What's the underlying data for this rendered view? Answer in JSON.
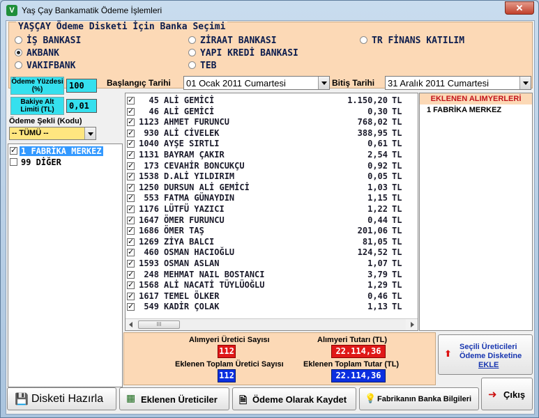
{
  "window": {
    "title": "Yaş Çay Bankamatik Ödeme İşlemleri",
    "close": "✕"
  },
  "bank_group": {
    "title": "YAŞÇAY Ödeme Disketi İçin Banka Seçimi",
    "options": [
      {
        "label": "İŞ BANKASI",
        "selected": false
      },
      {
        "label": "AKBANK",
        "selected": true
      },
      {
        "label": "VAKIFBANK",
        "selected": false
      },
      {
        "label": "ZİRAAT BANKASI",
        "selected": false
      },
      {
        "label": "YAPI KREDİ BANKASI",
        "selected": false
      },
      {
        "label": "TEB",
        "selected": false
      },
      {
        "label": "TR FİNANS KATILIM",
        "selected": false
      }
    ]
  },
  "params": {
    "payment_pct_label": "Ödeme Yüzdesi (%)",
    "payment_pct_value": "100",
    "debt_limit_label": "Bakiye Alt Limiti (TL)",
    "debt_limit_value": "0,01",
    "payment_type_label": "Ödeme Şekli (Kodu)",
    "payment_type_value": "-- TÜMÜ --",
    "start_label": "Başlangıç Tarihi",
    "start_value": "01   Ocak   2011 Cumartesi",
    "end_label": "Bitiş Tarihi",
    "end_value": "31  Aralık  2011 Cumartesi"
  },
  "factories": [
    {
      "label": "1 FABRİKA MERKEZ",
      "checked": true,
      "selected": true
    },
    {
      "label": "99 DİĞER",
      "checked": false,
      "selected": false
    }
  ],
  "producers": [
    {
      "code": "45",
      "name": "ALİ GEMİCİ",
      "amount": "1.150,20",
      "cur": "TL"
    },
    {
      "code": "46",
      "name": "ALİ GEMİCİ",
      "amount": "0,30",
      "cur": "TL"
    },
    {
      "code": "1123",
      "name": "AHMET FURUNCU",
      "amount": "768,02",
      "cur": "TL"
    },
    {
      "code": "930",
      "name": "ALİ CİVELEK",
      "amount": "388,95",
      "cur": "TL"
    },
    {
      "code": "1040",
      "name": "AYŞE SIRTLI",
      "amount": "0,61",
      "cur": "TL"
    },
    {
      "code": "1131",
      "name": "BAYRAM ÇAKIR",
      "amount": "2,54",
      "cur": "TL"
    },
    {
      "code": "173",
      "name": "CEVAHİR BONCUKÇU",
      "amount": "0,92",
      "cur": "TL"
    },
    {
      "code": "1538",
      "name": "D.ALİ YILDIRIM",
      "amount": "0,05",
      "cur": "TL"
    },
    {
      "code": "1250",
      "name": "DURSUN ALİ GEMİCİ",
      "amount": "1,03",
      "cur": "TL"
    },
    {
      "code": "553",
      "name": "FATMA GÜNAYDIN",
      "amount": "1,15",
      "cur": "TL"
    },
    {
      "code": "1176",
      "name": "LÜTFÜ YAZICI",
      "amount": "1,22",
      "cur": "TL"
    },
    {
      "code": "1647",
      "name": "ÖMER FURUNCU",
      "amount": "0,44",
      "cur": "TL"
    },
    {
      "code": "1686",
      "name": "ÖMER TAŞ",
      "amount": "201,06",
      "cur": "TL"
    },
    {
      "code": "1269",
      "name": "ZİYA BALCI",
      "amount": "81,05",
      "cur": "TL"
    },
    {
      "code": "460",
      "name": "OSMAN HACIOĞLU",
      "amount": "124,52",
      "cur": "TL"
    },
    {
      "code": "1593",
      "name": "OSMAN ASLAN",
      "amount": "1,07",
      "cur": "TL"
    },
    {
      "code": "248",
      "name": "MEHMAT NAIL BOSTANCI",
      "amount": "3,79",
      "cur": "TL"
    },
    {
      "code": "1568",
      "name": "ALİ  NACATİ TÜYLÜOĞLU",
      "amount": "1,29",
      "cur": "TL"
    },
    {
      "code": "1617",
      "name": "TEMEL ÖLKER",
      "amount": "0,46",
      "cur": "TL"
    },
    {
      "code": "549",
      "name": "KADİR ÇOLAK",
      "amount": "1,13",
      "cur": "TL"
    }
  ],
  "scroll_thumb": "III",
  "added_buyers": {
    "header": "EKLENEN ALIMYERLERİ",
    "items": [
      "1 FABRİKA MERKEZ"
    ]
  },
  "totals": {
    "producer_count_label": "Alımyeri Üretici Sayısı",
    "producer_count": "112",
    "amount_label": "Alımyeri Tutarı (TL)",
    "amount": "22.114,36",
    "added_count_label": "Eklenen Toplam Üretici Sayısı",
    "added_count": "112",
    "added_amount_label": "Eklenen Toplam Tutar (TL)",
    "added_amount": "22.114,36"
  },
  "add_button": {
    "line1": "Seçili Üreticileri",
    "line2": "Ödeme Disketine",
    "line3": "EKLE"
  },
  "buttons": {
    "prepare": "Disketi Hazırla",
    "added_producers": "Eklenen Üreticiler",
    "save_paid": "Ödeme Olarak Kaydet",
    "bank_info": "Fabrikanın Banka Bilgileri",
    "exit": "Çıkış"
  },
  "colors": {
    "orange_panel": "#fcd9b6",
    "red_box": "#e01818",
    "blue_box": "#0b2fe0",
    "cyan_box": "#35e0ee"
  }
}
